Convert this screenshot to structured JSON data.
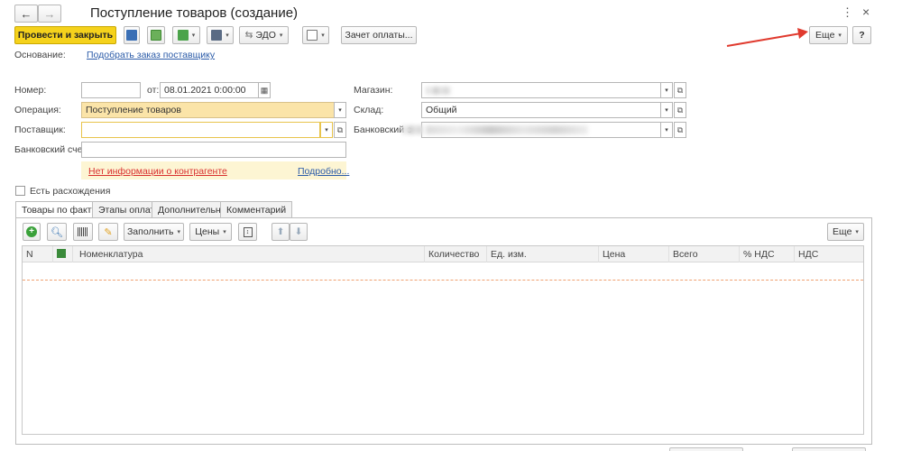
{
  "window": {
    "title": "Поступление товаров (создание)",
    "nav_back": "←",
    "nav_forward": "→",
    "more_dots": "⋮",
    "close": "×"
  },
  "toolbar": {
    "post_close": "Провести и закрыть",
    "edo": "ЭДО",
    "payment_offset": "Зачет оплаты...",
    "more": "Еще",
    "help": "?"
  },
  "basis": {
    "label": "Основание:",
    "link": "Подобрать заказ поставщику"
  },
  "form": {
    "number_label": "Номер:",
    "number_value": "",
    "date_from_label": "от:",
    "date_value": "08.01.2021  0:00:00",
    "operation_label": "Операция:",
    "operation_value": "Поступление товаров",
    "supplier_label": "Поставщик:",
    "supplier_value": "",
    "bank_account_label": "Банковский счет:",
    "bank_account_value": "",
    "no_info": "Нет информации о контрагенте",
    "more_link": "Подробно...",
    "store_label": "Магазин:",
    "warehouse_label": "Склад:",
    "warehouse_value": "Общий",
    "bank_label": "Банковский с",
    "discrepancy_label": "Есть расхождения"
  },
  "tabs": [
    "Товары по факту",
    "Этапы оплат",
    "Дополнительно",
    "Комментарий"
  ],
  "table_toolbar": {
    "fill": "Заполнить",
    "prices": "Цены",
    "more": "Еще"
  },
  "table": {
    "columns": [
      "N",
      "",
      "Номенклатура",
      "Количество",
      "Ед. изм.",
      "Цена",
      "Всего",
      "% НДС",
      "НДС"
    ]
  },
  "colors": {
    "primary_button": "#f5d21c",
    "arrow": "#e03a2e",
    "link": "#2b5ba8",
    "error_link": "#d93030"
  }
}
